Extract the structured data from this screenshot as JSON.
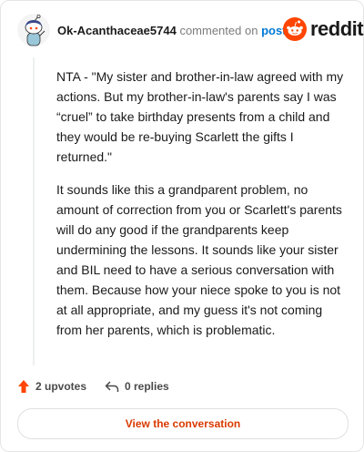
{
  "header": {
    "username": "Ok-Acanthaceae5744",
    "action_text": "commented on",
    "post_link": "post",
    "brand": "reddit",
    "brand_color": "#ff4500"
  },
  "comment": {
    "paragraphs": [
      "NTA - \"My sister and brother-in-law agreed with my actions. But my brother-in-law's parents say I was “cruel” to take birthday presents from a child and they would be re-buying Scarlett the gifts I returned.\"",
      "It sounds like this a grandparent problem, no amount of correction from you or Scarlett's parents will do any good if the grandparents keep undermining the lessons. It sounds like your sister and BIL need to have a serious conversation with them. Because how your niece spoke to you is not at all appropriate, and my guess it's not coming from her parents, which is problematic."
    ]
  },
  "meta": {
    "upvotes": "2 upvotes",
    "replies": "0 replies",
    "upvote_color": "#ff4500"
  },
  "cta": {
    "label": "View the conversation",
    "color": "#d93a00"
  },
  "icons": {
    "avatar": "snoo-avatar-icon",
    "brand_logo": "reddit-logo-icon",
    "upvote": "upvote-arrow-icon",
    "reply": "reply-arrow-icon"
  }
}
